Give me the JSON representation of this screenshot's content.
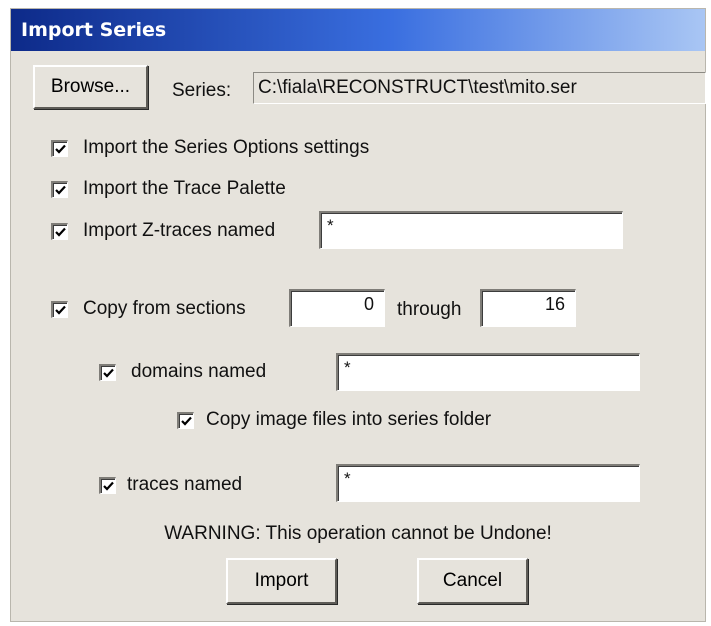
{
  "window": {
    "title": "Import Series"
  },
  "series": {
    "browse_label": "Browse...",
    "series_label": "Series:",
    "series_path": "C:\\fiala\\RECONSTRUCT\\test\\mito.ser"
  },
  "options": {
    "series_options": {
      "label": "Import the Series Options settings",
      "checked": true
    },
    "trace_palette": {
      "label": "Import the Trace Palette",
      "checked": true
    },
    "ztraces": {
      "label": "Import Z-traces named",
      "checked": true,
      "value": "*"
    },
    "copy_sections": {
      "label": "Copy from sections",
      "checked": true,
      "from": "0",
      "through_label": "through",
      "to": "16"
    },
    "domains": {
      "label": "domains named",
      "checked": true,
      "value": "*"
    },
    "copy_images": {
      "label": "Copy image files into series folder",
      "checked": true
    },
    "traces": {
      "label": "traces named",
      "checked": true,
      "value": "*"
    }
  },
  "warning": "WARNING: This operation cannot be Undone!",
  "buttons": {
    "import_label": "Import",
    "cancel_label": "Cancel"
  }
}
